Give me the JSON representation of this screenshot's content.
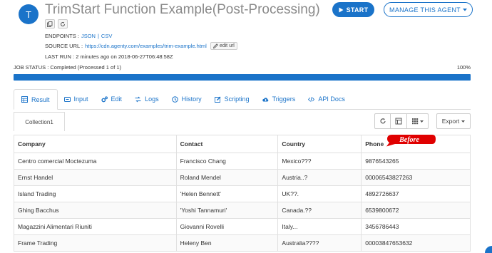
{
  "header": {
    "avatar_letter": "T",
    "title": "TrimStart Function Example(Post-Processing)",
    "start_label": "START",
    "manage_label": "MANAGE THIS AGENT"
  },
  "meta": {
    "endpoints_label": "ENDPOINTS :",
    "endpoint_json": "JSON",
    "separator": "|",
    "endpoint_csv": "CSV",
    "source_label": "SOURCE URL :",
    "source_url": "https://cdn.agenty.com/examples/trim-example.html",
    "edit_url_label": "edit url",
    "last_run": "LAST RUN : 2 minutes ago on 2018-06-27T06:48:58Z"
  },
  "job": {
    "status_text": "JOB STATUS : Completed (Processed 1 of 1)",
    "percent_text": "100%",
    "progress": 1.0
  },
  "tabs": [
    {
      "label": "Result",
      "icon": "table-icon",
      "active": true
    },
    {
      "label": "Input",
      "icon": "input-icon",
      "active": false
    },
    {
      "label": "Edit",
      "icon": "gears-icon",
      "active": false
    },
    {
      "label": "Logs",
      "icon": "logs-icon",
      "active": false
    },
    {
      "label": "History",
      "icon": "history-icon",
      "active": false
    },
    {
      "label": "Scripting",
      "icon": "pencil-icon",
      "active": false
    },
    {
      "label": "Triggers",
      "icon": "cloud-upload-icon",
      "active": false
    },
    {
      "label": "API Docs",
      "icon": "code-icon",
      "active": false
    }
  ],
  "collection": {
    "tab_label": "Collection1",
    "export_label": "Export"
  },
  "table": {
    "headers": [
      "Company",
      "Contact",
      "Country",
      "Phone"
    ],
    "rows": [
      [
        "Centro comercial Moctezuma",
        "Francisco Chang",
        "Mexico???",
        "9876543265"
      ],
      [
        "Ernst Handel",
        "Roland Mendel",
        "Austria..?",
        "00006543827263"
      ],
      [
        "Island Trading",
        "'Helen Bennett'",
        "UK??.",
        "4892726637"
      ],
      [
        "Ghing Bacchus",
        "'Yoshi Tannamuri'",
        "Canada.??",
        "6539800672"
      ],
      [
        "Magazzini Alimentari Riuniti",
        "Giovanni Rovelli",
        "Italy...",
        "3456786443"
      ],
      [
        "Frame Trading",
        "Heleny Ben",
        "Australia????",
        "00003847653632"
      ]
    ]
  },
  "annotation": {
    "text": "Before",
    "color": "#e00000"
  },
  "colors": {
    "accent": "#1a73c9"
  }
}
